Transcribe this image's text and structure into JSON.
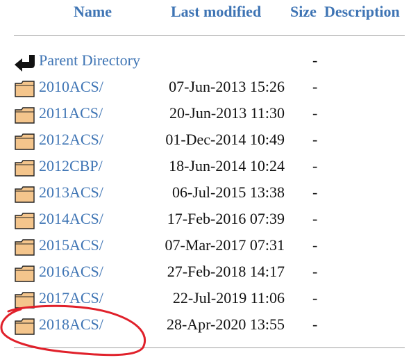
{
  "header": {
    "name": "Name",
    "last_modified": "Last modified",
    "size": "Size",
    "description": "Description"
  },
  "parent": {
    "label": "Parent Directory",
    "size": "-",
    "icon": "back-arrow-icon"
  },
  "rows": [
    {
      "name": "2010ACS/",
      "modified": "07-Jun-2013 15:26",
      "size": "-",
      "icon": "folder-icon"
    },
    {
      "name": "2011ACS/",
      "modified": "20-Jun-2013 11:30",
      "size": "-",
      "icon": "folder-icon"
    },
    {
      "name": "2012ACS/",
      "modified": "01-Dec-2014 10:49",
      "size": "-",
      "icon": "folder-icon"
    },
    {
      "name": "2012CBP/",
      "modified": "18-Jun-2014 10:24",
      "size": "-",
      "icon": "folder-icon"
    },
    {
      "name": "2013ACS/",
      "modified": "06-Jul-2015 13:38",
      "size": "-",
      "icon": "folder-icon"
    },
    {
      "name": "2014ACS/",
      "modified": "17-Feb-2016 07:39",
      "size": "-",
      "icon": "folder-icon"
    },
    {
      "name": "2015ACS/",
      "modified": "07-Mar-2017 07:31",
      "size": "-",
      "icon": "folder-icon"
    },
    {
      "name": "2016ACS/",
      "modified": "27-Feb-2018 14:17",
      "size": "-",
      "icon": "folder-icon"
    },
    {
      "name": "2017ACS/",
      "modified": "22-Jul-2019 11:06",
      "size": "-",
      "icon": "folder-icon"
    },
    {
      "name": "2018ACS/",
      "modified": "28-Apr-2020 13:55",
      "size": "-",
      "icon": "folder-icon"
    }
  ],
  "colors": {
    "link": "#3e74b4",
    "folder_fill": "#f4c58c",
    "annotation": "#e0202a"
  }
}
